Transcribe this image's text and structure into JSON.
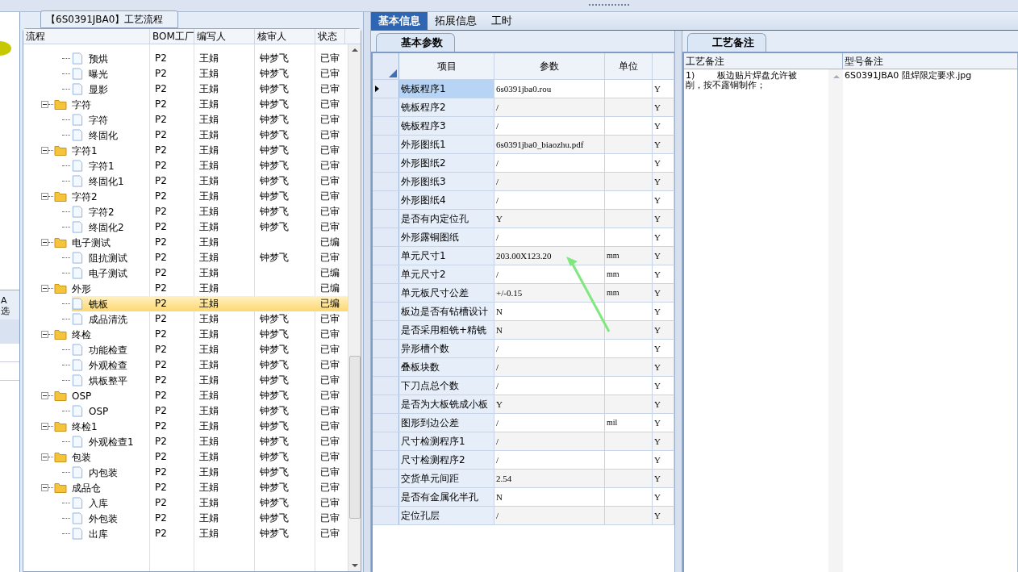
{
  "left_stub": {
    "lines": [
      "A",
      "选"
    ]
  },
  "flow_panel": {
    "title": "【6S0391JBA0】工艺流程",
    "columns": [
      "流程",
      "BOM工厂",
      "编写人",
      "核审人",
      "状态"
    ],
    "tree": [
      {
        "children": [
          {
            "label": "预烘",
            "factory": "P2",
            "writer": "王娟",
            "reviewer": "钟梦飞",
            "status": "已审",
            "selected": false
          },
          {
            "label": "曝光",
            "factory": "P2",
            "writer": "王娟",
            "reviewer": "钟梦飞",
            "status": "已审",
            "selected": false
          },
          {
            "label": "显影",
            "factory": "P2",
            "writer": "王娟",
            "reviewer": "钟梦飞",
            "status": "已审",
            "selected": false
          }
        ]
      },
      {
        "label": "字符",
        "factory": "P2",
        "writer": "王娟",
        "reviewer": "钟梦飞",
        "status": "已审",
        "selected": false,
        "expanded": true,
        "children": [
          {
            "label": "字符",
            "factory": "P2",
            "writer": "王娟",
            "reviewer": "钟梦飞",
            "status": "已审",
            "selected": false
          },
          {
            "label": "终固化",
            "factory": "P2",
            "writer": "王娟",
            "reviewer": "钟梦飞",
            "status": "已审",
            "selected": false
          }
        ]
      },
      {
        "label": "字符1",
        "factory": "P2",
        "writer": "王娟",
        "reviewer": "钟梦飞",
        "status": "已审",
        "selected": false,
        "expanded": true,
        "children": [
          {
            "label": "字符1",
            "factory": "P2",
            "writer": "王娟",
            "reviewer": "钟梦飞",
            "status": "已审",
            "selected": false
          },
          {
            "label": "终固化1",
            "factory": "P2",
            "writer": "王娟",
            "reviewer": "钟梦飞",
            "status": "已审",
            "selected": false
          }
        ]
      },
      {
        "label": "字符2",
        "factory": "P2",
        "writer": "王娟",
        "reviewer": "钟梦飞",
        "status": "已审",
        "selected": false,
        "expanded": true,
        "children": [
          {
            "label": "字符2",
            "factory": "P2",
            "writer": "王娟",
            "reviewer": "钟梦飞",
            "status": "已审",
            "selected": false
          },
          {
            "label": "终固化2",
            "factory": "P2",
            "writer": "王娟",
            "reviewer": "钟梦飞",
            "status": "已审",
            "selected": false
          }
        ]
      },
      {
        "label": "电子测试",
        "factory": "P2",
        "writer": "王娟",
        "status": "已编",
        "selected": false,
        "expanded": true,
        "children": [
          {
            "label": "阻抗测试",
            "factory": "P2",
            "writer": "王娟",
            "reviewer": "钟梦飞",
            "status": "已审",
            "selected": false
          },
          {
            "label": "电子测试",
            "factory": "P2",
            "writer": "王娟",
            "status": "已编",
            "selected": false
          }
        ]
      },
      {
        "label": "外形",
        "factory": "P2",
        "writer": "王娟",
        "status": "已编",
        "selected": false,
        "expanded": true,
        "children": [
          {
            "label": "铣板",
            "factory": "P2",
            "writer": "王娟",
            "status": "已编",
            "selected": true
          },
          {
            "label": "成品清洗",
            "factory": "P2",
            "writer": "王娟",
            "reviewer": "钟梦飞",
            "status": "已审",
            "selected": false
          }
        ]
      },
      {
        "label": "终检",
        "factory": "P2",
        "writer": "王娟",
        "reviewer": "钟梦飞",
        "status": "已审",
        "selected": false,
        "expanded": true,
        "children": [
          {
            "label": "功能检查",
            "factory": "P2",
            "writer": "王娟",
            "reviewer": "钟梦飞",
            "status": "已审",
            "selected": false
          },
          {
            "label": "外观检查",
            "factory": "P2",
            "writer": "王娟",
            "reviewer": "钟梦飞",
            "status": "已审",
            "selected": false
          },
          {
            "label": "烘板整平",
            "factory": "P2",
            "writer": "王娟",
            "reviewer": "钟梦飞",
            "status": "已审",
            "selected": false
          }
        ]
      },
      {
        "label": "OSP",
        "factory": "P2",
        "writer": "王娟",
        "reviewer": "钟梦飞",
        "status": "已审",
        "selected": false,
        "expanded": true,
        "children": [
          {
            "label": "OSP",
            "factory": "P2",
            "writer": "王娟",
            "reviewer": "钟梦飞",
            "status": "已审",
            "selected": false
          }
        ]
      },
      {
        "label": "终检1",
        "factory": "P2",
        "writer": "王娟",
        "reviewer": "钟梦飞",
        "status": "已审",
        "selected": false,
        "expanded": true,
        "children": [
          {
            "label": "外观检查1",
            "factory": "P2",
            "writer": "王娟",
            "reviewer": "钟梦飞",
            "status": "已审",
            "selected": false
          }
        ]
      },
      {
        "label": "包装",
        "factory": "P2",
        "writer": "王娟",
        "reviewer": "钟梦飞",
        "status": "已审",
        "selected": false,
        "expanded": true,
        "children": [
          {
            "label": "内包装",
            "factory": "P2",
            "writer": "王娟",
            "reviewer": "钟梦飞",
            "status": "已审",
            "selected": false
          }
        ]
      },
      {
        "label": "成品仓",
        "factory": "P2",
        "writer": "王娟",
        "reviewer": "钟梦飞",
        "status": "已审",
        "selected": false,
        "expanded": true,
        "children": [
          {
            "label": "入库",
            "factory": "P2",
            "writer": "王娟",
            "reviewer": "钟梦飞",
            "status": "已审",
            "selected": false
          },
          {
            "label": "外包装",
            "factory": "P2",
            "writer": "王娟",
            "reviewer": "钟梦飞",
            "status": "已审",
            "selected": false
          },
          {
            "label": "出库",
            "factory": "P2",
            "writer": "王娟",
            "reviewer": "钟梦飞",
            "status": "已审",
            "selected": false
          }
        ]
      }
    ]
  },
  "tabs": [
    {
      "label": "基本信息",
      "selected": true
    },
    {
      "label": "拓展信息",
      "selected": false
    },
    {
      "label": "工时",
      "selected": false
    }
  ],
  "params_panel": {
    "tab": "基本参数",
    "columns": [
      "项目",
      "参数",
      "单位"
    ],
    "rows": [
      {
        "item": "铣板程序1",
        "param": "6s0391jba0.rou",
        "column_5": "Y",
        "selected": true
      },
      {
        "item": "铣板程序2",
        "param": "/",
        "column_5": "Y",
        "selected": false
      },
      {
        "item": "铣板程序3",
        "param": "/",
        "column_5": "Y",
        "selected": false
      },
      {
        "item": "外形图纸1",
        "param": "6s0391jba0_biaozhu.pdf",
        "column_5": "Y",
        "selected": false
      },
      {
        "item": "外形图纸2",
        "param": "/",
        "column_5": "Y",
        "selected": false
      },
      {
        "item": "外形图纸3",
        "param": "/",
        "column_5": "Y",
        "selected": false
      },
      {
        "item": "外形图纸4",
        "param": "/",
        "column_5": "Y",
        "selected": false
      },
      {
        "item": "是否有内定位孔",
        "param": "Y",
        "column_5": "Y",
        "selected": false
      },
      {
        "item": "外形露铜图纸",
        "param": "/",
        "column_5": "Y",
        "selected": false
      },
      {
        "item": "单元尺寸1",
        "param": "203.00X123.20",
        "unit": "mm",
        "column_5": "Y",
        "selected": false
      },
      {
        "item": "单元尺寸2",
        "param": "/",
        "unit": "mm",
        "column_5": "Y",
        "selected": false
      },
      {
        "item": "单元板尺寸公差",
        "param": "+/-0.15",
        "unit": "mm",
        "column_5": "Y",
        "selected": false
      },
      {
        "item": "板边是否有钻槽设计",
        "param": "N",
        "column_5": "Y",
        "selected": false
      },
      {
        "item": "是否采用粗铣+精铣",
        "param": "N",
        "column_5": "Y",
        "selected": false
      },
      {
        "item": "异形槽个数",
        "param": "/",
        "column_5": "Y",
        "selected": false
      },
      {
        "item": "叠板块数",
        "param": "/",
        "column_5": "Y",
        "selected": false
      },
      {
        "item": "下刀点总个数",
        "param": "/",
        "column_5": "Y",
        "selected": false
      },
      {
        "item": "是否为大板铣成小板",
        "param": "Y",
        "column_5": "Y",
        "selected": false
      },
      {
        "item": "图形到边公差",
        "param": "/",
        "unit": "mil",
        "column_5": "Y",
        "selected": false
      },
      {
        "item": "尺寸检测程序1",
        "param": "/",
        "column_5": "Y",
        "selected": false
      },
      {
        "item": "尺寸检测程序2",
        "param": "/",
        "column_5": "Y",
        "selected": false
      },
      {
        "item": "交货单元间距",
        "param": "2.54",
        "column_5": "Y",
        "selected": false
      },
      {
        "item": "是否有金属化半孔",
        "param": "N",
        "column_5": "Y",
        "selected": false
      },
      {
        "item": "定位孔层",
        "param": "/",
        "column_5": "Y",
        "selected": false
      }
    ]
  },
  "notes_panel": {
    "tab": "工艺备注",
    "columns": [
      "工艺备注",
      "型号备注"
    ],
    "process_note": "1)        板边贴片焊盘允许被削，按不露铜制作；",
    "model_note": "6S0391JBA0 阻焊限定要求.jpg"
  }
}
